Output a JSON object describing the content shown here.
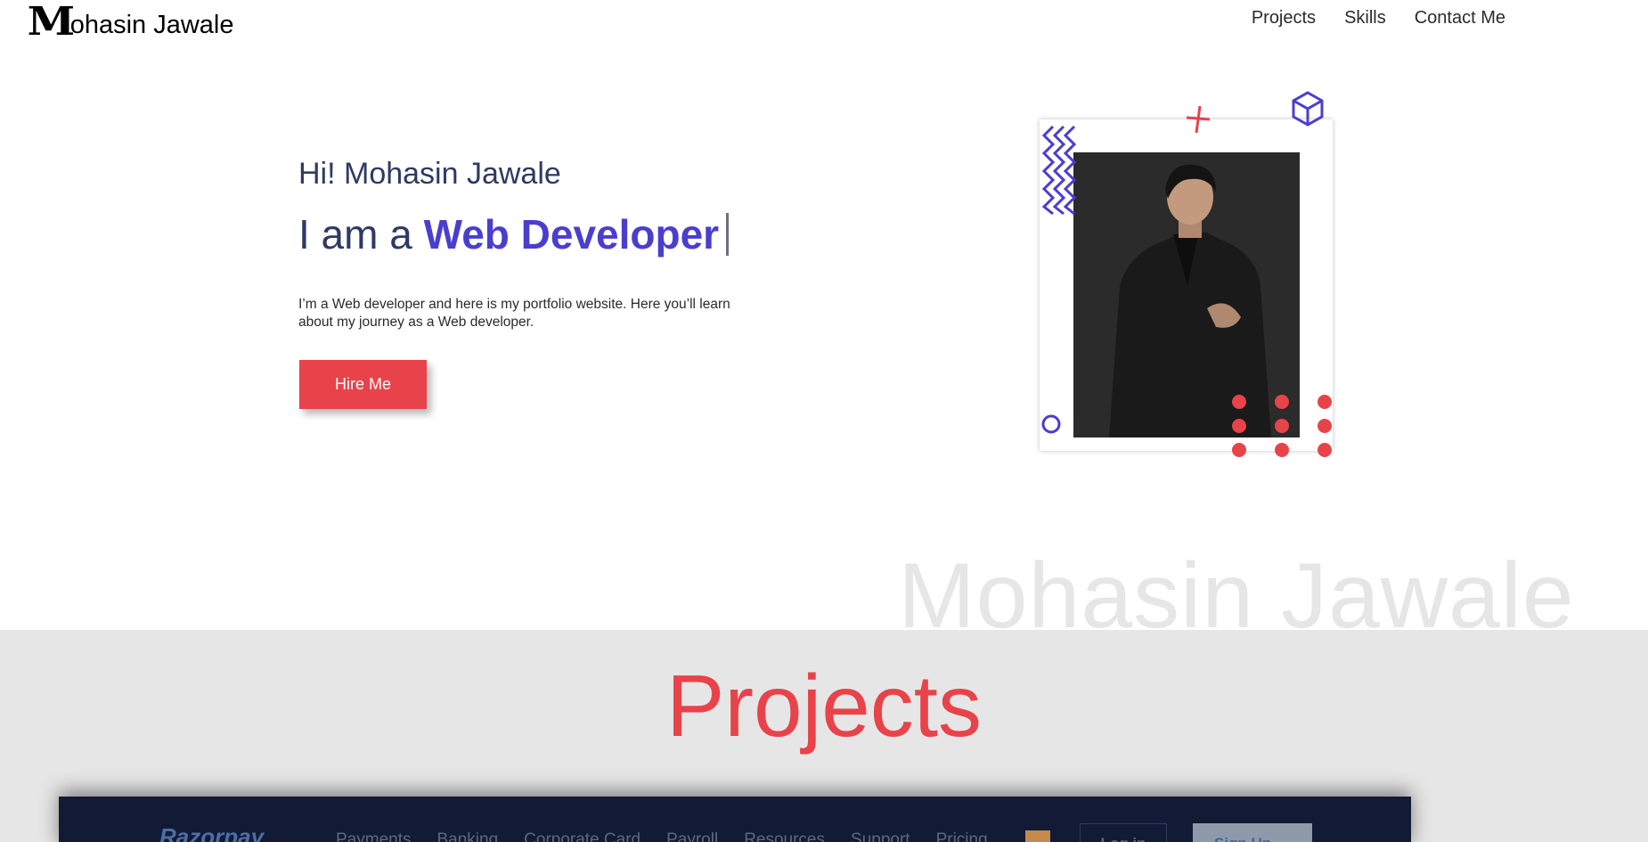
{
  "header": {
    "logo_initial": "M",
    "logo_rest": "ohasin Jawale",
    "nav": [
      "Projects",
      "Skills",
      "Contact Me"
    ]
  },
  "hero": {
    "greeting": "Hi! Mohasin Jawale",
    "role_prefix": "I am a",
    "role_highlight": "Web Developer",
    "description": "I’m a Web developer and here is my portfolio website. Here you’ll learn about my journey as a Web developer.",
    "cta_label": "Hire Me"
  },
  "watermark": "Mohasin Jawale",
  "projects": {
    "title": "Projects",
    "preview": {
      "logo": "Razorpay",
      "nav": [
        "Payments",
        "Banking",
        "Corporate Card",
        "Payroll",
        "Resources",
        "Support",
        "Pricing"
      ],
      "login_label": "Log in",
      "signup_label": "Sign Up"
    }
  },
  "colors": {
    "accent_red": "#e8434a",
    "accent_purple": "#4a3ecf",
    "text_navy": "#2f3a63",
    "section_gray": "#e6e6e6"
  },
  "icons": [
    "zigzag-icon",
    "plus-icon",
    "cube-icon",
    "circle-icon",
    "dot-grid-icon",
    "arrow-right-icon"
  ]
}
